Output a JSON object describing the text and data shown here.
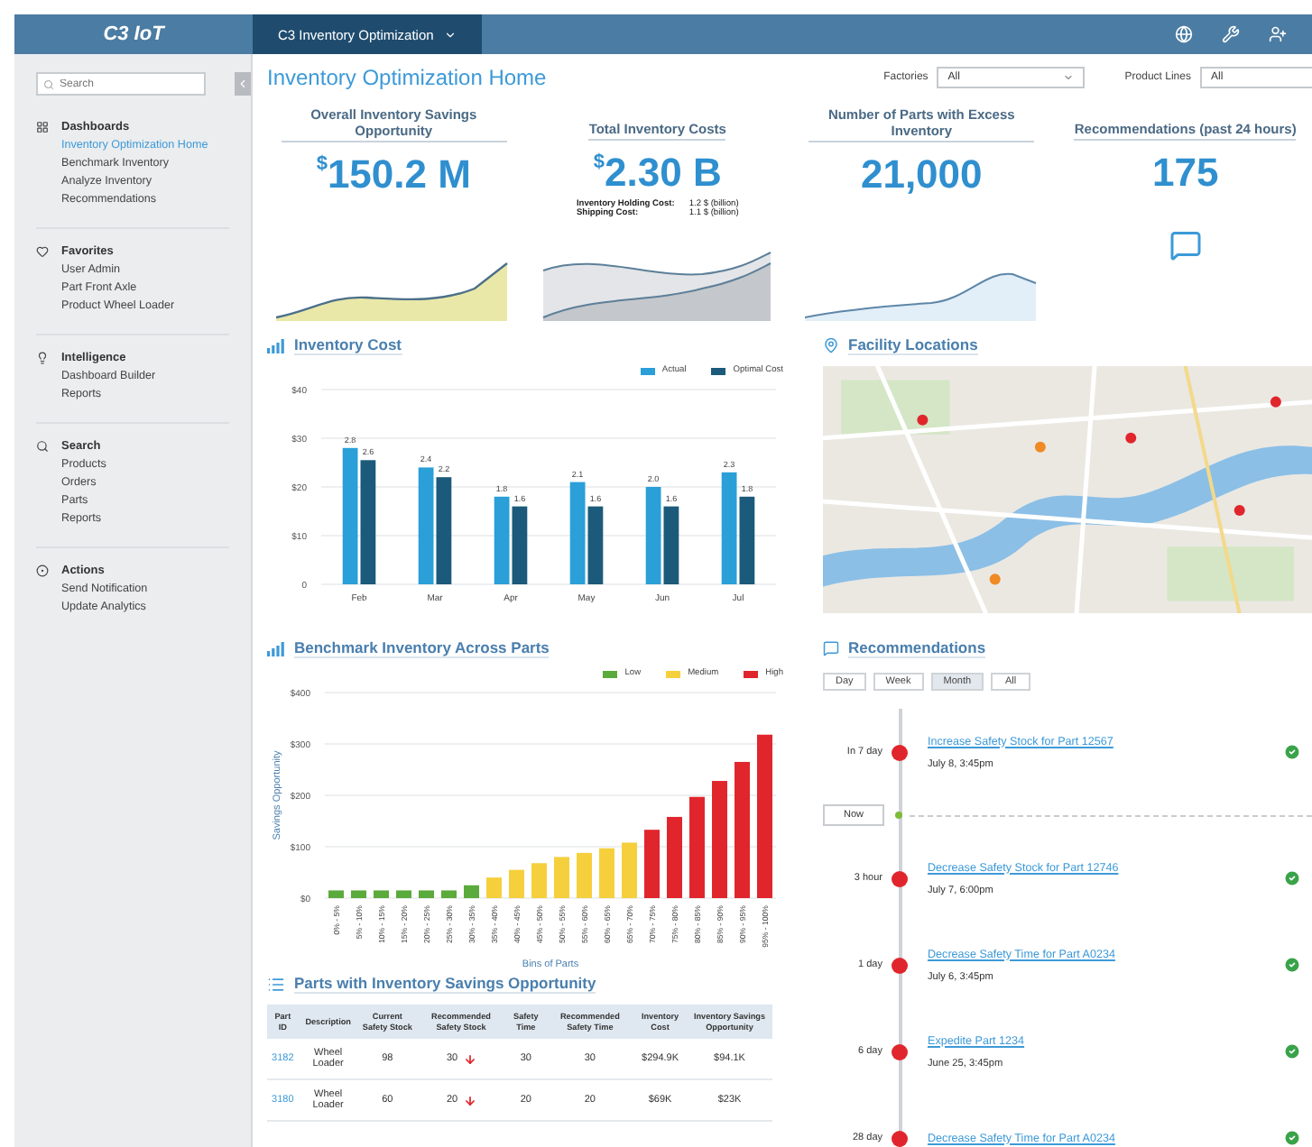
{
  "top_bar": {
    "logo": "C3 IoT",
    "app_switcher": "C3 Inventory Optimization"
  },
  "sidebar": {
    "search": {
      "placeholder": "Search"
    },
    "sections": [
      {
        "title": "Dashboards",
        "items": [
          {
            "label": "Inventory Optimization Home",
            "selected": true
          },
          {
            "label": "Benchmark Inventory",
            "selected": false
          },
          {
            "label": "Analyze Inventory",
            "selected": false
          },
          {
            "label": "Recommendations",
            "selected": false
          }
        ]
      },
      {
        "title": "Favorites",
        "items": [
          {
            "label": "User Admin",
            "selected": false
          },
          {
            "label": "Part Front Axle",
            "selected": false
          },
          {
            "label": "Product Wheel Loader",
            "selected": false
          }
        ]
      },
      {
        "title": "Intelligence",
        "items": [
          {
            "label": "Dashboard Builder",
            "selected": false
          },
          {
            "label": "Reports",
            "selected": false
          }
        ]
      },
      {
        "title": "Search",
        "items": [
          {
            "label": "Products",
            "selected": false
          },
          {
            "label": "Orders",
            "selected": false
          },
          {
            "label": "Parts",
            "selected": false
          },
          {
            "label": "Reports",
            "selected": false
          }
        ]
      },
      {
        "title": "Actions",
        "items": [
          {
            "label": "Send Notification",
            "selected": false
          },
          {
            "label": "Update Analytics",
            "selected": false
          }
        ]
      }
    ]
  },
  "page": {
    "title": "Inventory Optimization Home",
    "filters": [
      {
        "label": "Factories",
        "value": "All"
      },
      {
        "label": "Product Lines",
        "value": "All"
      }
    ]
  },
  "kpis": [
    {
      "kind": "sparkline",
      "title": "Overall Inventory Savings Opportunity",
      "prefix": "$",
      "value": "150.2 M"
    },
    {
      "kind": "sparkline",
      "title": "Total Inventory Costs",
      "prefix": "$",
      "value": "2.30 B",
      "details": [
        {
          "label": "Inventory Holding Cost:",
          "value": "1.2 $ (billion)"
        },
        {
          "label": "Shipping Cost:",
          "value": "1.1 $ (billion)"
        }
      ]
    },
    {
      "kind": "sparkline",
      "title": "Number of Parts with Excess Inventory",
      "value": "21,000"
    },
    {
      "kind": "icon",
      "title": "Recommendations (past 24 hours)",
      "value": "175"
    }
  ],
  "inventory_cost": {
    "title": "Inventory Cost",
    "chart_data": {
      "type": "bar",
      "categories": [
        "Feb",
        "Mar",
        "Apr",
        "May",
        "Jun",
        "Jul"
      ],
      "series": [
        {
          "name": "Actual",
          "color": "#2a9fd8",
          "values": [
            28,
            24,
            18,
            21,
            20,
            23
          ]
        },
        {
          "name": "Optimal Cost",
          "color": "#1b5a7a",
          "values": [
            25.5,
            22,
            16,
            16,
            16,
            18
          ]
        }
      ],
      "ylim": [
        0,
        40
      ],
      "grid": true,
      "yticks": [
        {
          "value": 0,
          "label": "0"
        },
        {
          "value": 10,
          "label": "$10"
        },
        {
          "value": 20,
          "label": "$20"
        },
        {
          "value": 30,
          "label": "$30"
        },
        {
          "value": 40,
          "label": "$40"
        }
      ],
      "value_labels": [
        [
          "2.8",
          "2.4",
          "1.8",
          "2.1",
          "2.0",
          "2.3"
        ],
        [
          "2.6",
          "2.2",
          "1.6",
          "1.6",
          "1.6",
          "1.8"
        ]
      ]
    }
  },
  "benchmark": {
    "title": "Benchmark Inventory Across Parts",
    "chart_data": {
      "type": "bar",
      "ylabel": "Savings Opportunity",
      "xlabel": "Bins of Parts",
      "categories": [
        "0% - 5%",
        "5% - 10%",
        "10% - 15%",
        "15% - 20%",
        "20% - 25%",
        "25% - 30%",
        "30% - 35%",
        "35% - 40%",
        "40% - 45%",
        "45% - 50%",
        "50% - 55%",
        "55% - 60%",
        "60% - 65%",
        "65% - 70%",
        "70% - 75%",
        "75% - 80%",
        "80% - 85%",
        "85% - 90%",
        "90% - 95%",
        "95% - 100%"
      ],
      "series": [
        {
          "name": "Low",
          "color": "#5aaa3c",
          "values": [
            15,
            15,
            15,
            15,
            15,
            15,
            25,
            null,
            null,
            null,
            null,
            null,
            null,
            null,
            null,
            null,
            null,
            null,
            null,
            null
          ]
        },
        {
          "name": "Medium",
          "color": "#f5d03c",
          "values": [
            null,
            null,
            null,
            null,
            null,
            null,
            null,
            40,
            55,
            68,
            80,
            88,
            97,
            108,
            null,
            null,
            null,
            null,
            null,
            null
          ]
        },
        {
          "name": "High",
          "color": "#e0262c",
          "values": [
            null,
            null,
            null,
            null,
            null,
            null,
            null,
            null,
            null,
            null,
            null,
            null,
            null,
            null,
            133,
            158,
            197,
            228,
            265,
            318
          ]
        }
      ],
      "ylim": [
        0,
        400
      ],
      "grid": true,
      "yticks": [
        {
          "value": 0,
          "label": "$0"
        },
        {
          "value": 100,
          "label": "$100"
        },
        {
          "value": 200,
          "label": "$200"
        },
        {
          "value": 300,
          "label": "$300"
        },
        {
          "value": 400,
          "label": "$400"
        }
      ]
    }
  },
  "parts_table": {
    "title": "Parts with Inventory Savings Opportunity",
    "columns": [
      "Part ID",
      "Description",
      "Current Safety Stock",
      "Recommended Safety Stock",
      "Safety Time",
      "Recommended Safety Time",
      "Inventory Cost",
      "Inventory Savings Opportunity"
    ],
    "rows": [
      {
        "cells": [
          "3182",
          "Wheel Loader",
          "98",
          "30",
          "30",
          "30",
          "$294.9K",
          "$94.1K"
        ],
        "decrease": true
      },
      {
        "cells": [
          "3180",
          "Wheel Loader",
          "60",
          "20",
          "20",
          "20",
          "$69K",
          "$23K"
        ],
        "decrease": true
      }
    ]
  },
  "facility_locations": {
    "title": "Facility Locations"
  },
  "recommendations": {
    "title": "Recommendations",
    "filters": [
      {
        "label": "Day",
        "selected": false
      },
      {
        "label": "Week",
        "selected": false
      },
      {
        "label": "Month",
        "selected": true
      },
      {
        "label": "All",
        "selected": false
      }
    ],
    "timeline": [
      {
        "kind": "event",
        "ago": "In 7 day",
        "title": "Increase Safety Stock for Part 12567",
        "date": "July 8, 3:45pm",
        "done": true
      },
      {
        "kind": "now",
        "label": "Now"
      },
      {
        "kind": "event",
        "ago": "3 hour",
        "title": "Decrease Safety Stock for Part 12746",
        "date": "July 7, 6:00pm",
        "done": true
      },
      {
        "kind": "event",
        "ago": "1 day",
        "title": "Decrease Safety Time for Part A0234",
        "date": "July 6, 3:45pm",
        "done": true
      },
      {
        "kind": "event",
        "ago": "6 day",
        "title": "Expedite Part 1234",
        "date": "June 25, 3:45pm",
        "done": true
      },
      {
        "kind": "event",
        "ago": "28 day",
        "title": "Decrease Safety Time for Part A0234",
        "done": true
      }
    ]
  }
}
